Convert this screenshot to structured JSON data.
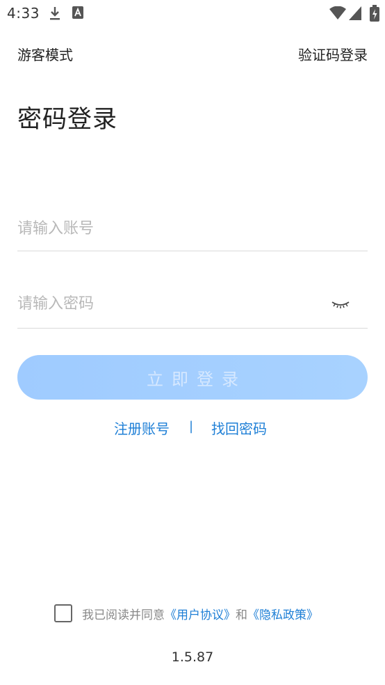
{
  "status_bar": {
    "time": "4:33",
    "icons": [
      "download-icon",
      "a-notification-icon",
      "wifi-icon",
      "signal-icon",
      "battery-icon"
    ]
  },
  "nav": {
    "guest_mode": "游客模式",
    "sms_login": "验证码登录"
  },
  "title": "密码登录",
  "form": {
    "account_placeholder": "请输入账号",
    "password_placeholder": "请输入密码",
    "password_toggle_icon": "eye-closed-icon",
    "login_button": "立即登录"
  },
  "links": {
    "register": "注册账号",
    "separator": "|",
    "forgot": "找回密码"
  },
  "agreement": {
    "prefix": "我已阅读并同意",
    "user_agreement": "《用户协议》",
    "and": "和",
    "privacy_policy": "《隐私政策》"
  },
  "version": "1.5.87",
  "colors": {
    "accent": "#1e7fd6",
    "button_bg": "#a3cdff",
    "placeholder": "#b8b8b8"
  }
}
